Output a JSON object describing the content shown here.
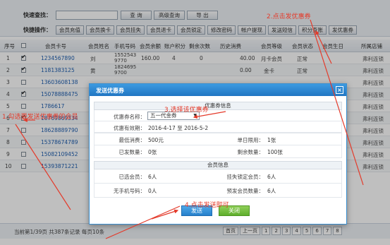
{
  "toolbar": {
    "search_label": "快速查找：",
    "search_value": "",
    "query_btn": "查 询",
    "advanced_btn": "高级查询",
    "export_btn": "导 出",
    "ops_label": "快捷操作：",
    "ops": [
      "会员充值",
      "会员换卡",
      "会员挂失",
      "会员退卡",
      "会员锁定",
      "修改密码",
      "帐户提现",
      "发送短信",
      "积分查账",
      "发优惠券"
    ]
  },
  "table": {
    "headers": [
      "序号",
      "",
      "会员卡号",
      "会员姓名",
      "手机号码",
      "会员余额",
      "账户积分",
      "剩余次数",
      "历史消费",
      "会员等级",
      "会员状态",
      "会员生日",
      "所属店铺"
    ],
    "rows": [
      {
        "no": "1",
        "checked": true,
        "card": "1234567890",
        "name": "刘",
        "phone": "15525439770",
        "balance": "160.00",
        "points": "4",
        "times": "0",
        "history": "40.00",
        "level": "月卡会员",
        "status": "正常",
        "birthday": "",
        "store": "弗利连锁"
      },
      {
        "no": "2",
        "checked": true,
        "card": "1181383125",
        "name": "黄",
        "phone": "18246959700",
        "balance": "",
        "points": "",
        "times": "",
        "history": "0.00",
        "level": "金卡",
        "status": "正常",
        "birthday": "",
        "store": "弗利连锁"
      },
      {
        "no": "3",
        "checked": false,
        "card": "13603608138",
        "name": "",
        "phone": "",
        "balance": "",
        "points": "",
        "times": "",
        "history": "",
        "level": "",
        "status": "",
        "birthday": "",
        "store": "弗利连锁"
      },
      {
        "no": "4",
        "checked": true,
        "card": "15078888475",
        "name": "",
        "phone": "",
        "balance": "",
        "points": "",
        "times": "",
        "history": "",
        "level": "",
        "status": "",
        "birthday": "",
        "store": "弗利连锁"
      },
      {
        "no": "5",
        "checked": false,
        "card": "1786617",
        "name": "",
        "phone": "",
        "balance": "",
        "points": "",
        "times": "",
        "history": "",
        "level": "",
        "status": "",
        "birthday": "",
        "store": "弗利连锁"
      },
      {
        "no": "6",
        "checked": true,
        "card": "18769869334",
        "name": "",
        "phone": "",
        "balance": "",
        "points": "",
        "times": "",
        "history": "",
        "level": "",
        "status": "",
        "birthday": "",
        "store": "弗利连锁"
      },
      {
        "no": "7",
        "checked": false,
        "card": "18628889790",
        "name": "",
        "phone": "",
        "balance": "",
        "points": "",
        "times": "",
        "history": "",
        "level": "",
        "status": "",
        "birthday": "",
        "store": "弗利连锁"
      },
      {
        "no": "8",
        "checked": false,
        "card": "15378674789",
        "name": "",
        "phone": "",
        "balance": "",
        "points": "",
        "times": "",
        "history": "",
        "level": "",
        "status": "",
        "birthday": "",
        "store": "弗利连锁"
      },
      {
        "no": "9",
        "checked": false,
        "card": "15082109452",
        "name": "",
        "phone": "",
        "balance": "",
        "points": "",
        "times": "",
        "history": "",
        "level": "",
        "status": "",
        "birthday": "",
        "store": "弗利连锁"
      },
      {
        "no": "10",
        "checked": false,
        "card": "15393871221",
        "name": "",
        "phone": "",
        "balance": "",
        "points": "",
        "times": "",
        "history": "",
        "level": "",
        "status": "",
        "birthday": "",
        "store": "弗利连锁"
      }
    ]
  },
  "footer": {
    "summary": "当前第1/39页 共387条记录 每页10条",
    "pages": [
      "首页",
      "上一页",
      "1",
      "2",
      "3",
      "4",
      "5",
      "6",
      "7",
      "8"
    ]
  },
  "modal": {
    "title": "发送优惠券",
    "section_coupon": "优惠券信息",
    "coupon_name_label": "优惠券名称：",
    "coupon_name_value": "五一代金券",
    "valid_label": "优惠有效期：",
    "valid_value": "2016-4-17 至 2016-5-2",
    "min_spend_label": "最低消费：",
    "min_spend_value": "500元",
    "single_limit_label": "单日限用：",
    "single_limit_value": "1张",
    "issued_label": "已发数量：",
    "issued_value": "0张",
    "remaining_label": "剩余数量：",
    "remaining_value": "100张",
    "section_member": "会员信息",
    "selected_label": "已选会员：",
    "selected_value": "6人",
    "locked_label": "挂失锁定会员：",
    "locked_value": "6人",
    "nophone_label": "无手机号码：",
    "nophone_value": "0人",
    "expected_label": "预发会员数量：",
    "expected_value": "6人",
    "send_btn": "发送",
    "close_btn": "关闭"
  },
  "annotations": {
    "step1": "1.勾选要发送优惠券的会员",
    "step2": "2.点击发优惠券",
    "step3": "3.选择该优惠券",
    "step4": "4.点击发送即可"
  },
  "colors": {
    "annotation": "#e43a2a",
    "modal_header": "#2c86cf",
    "send_button": "#2f89d3",
    "close_button": "#6cb83a"
  }
}
